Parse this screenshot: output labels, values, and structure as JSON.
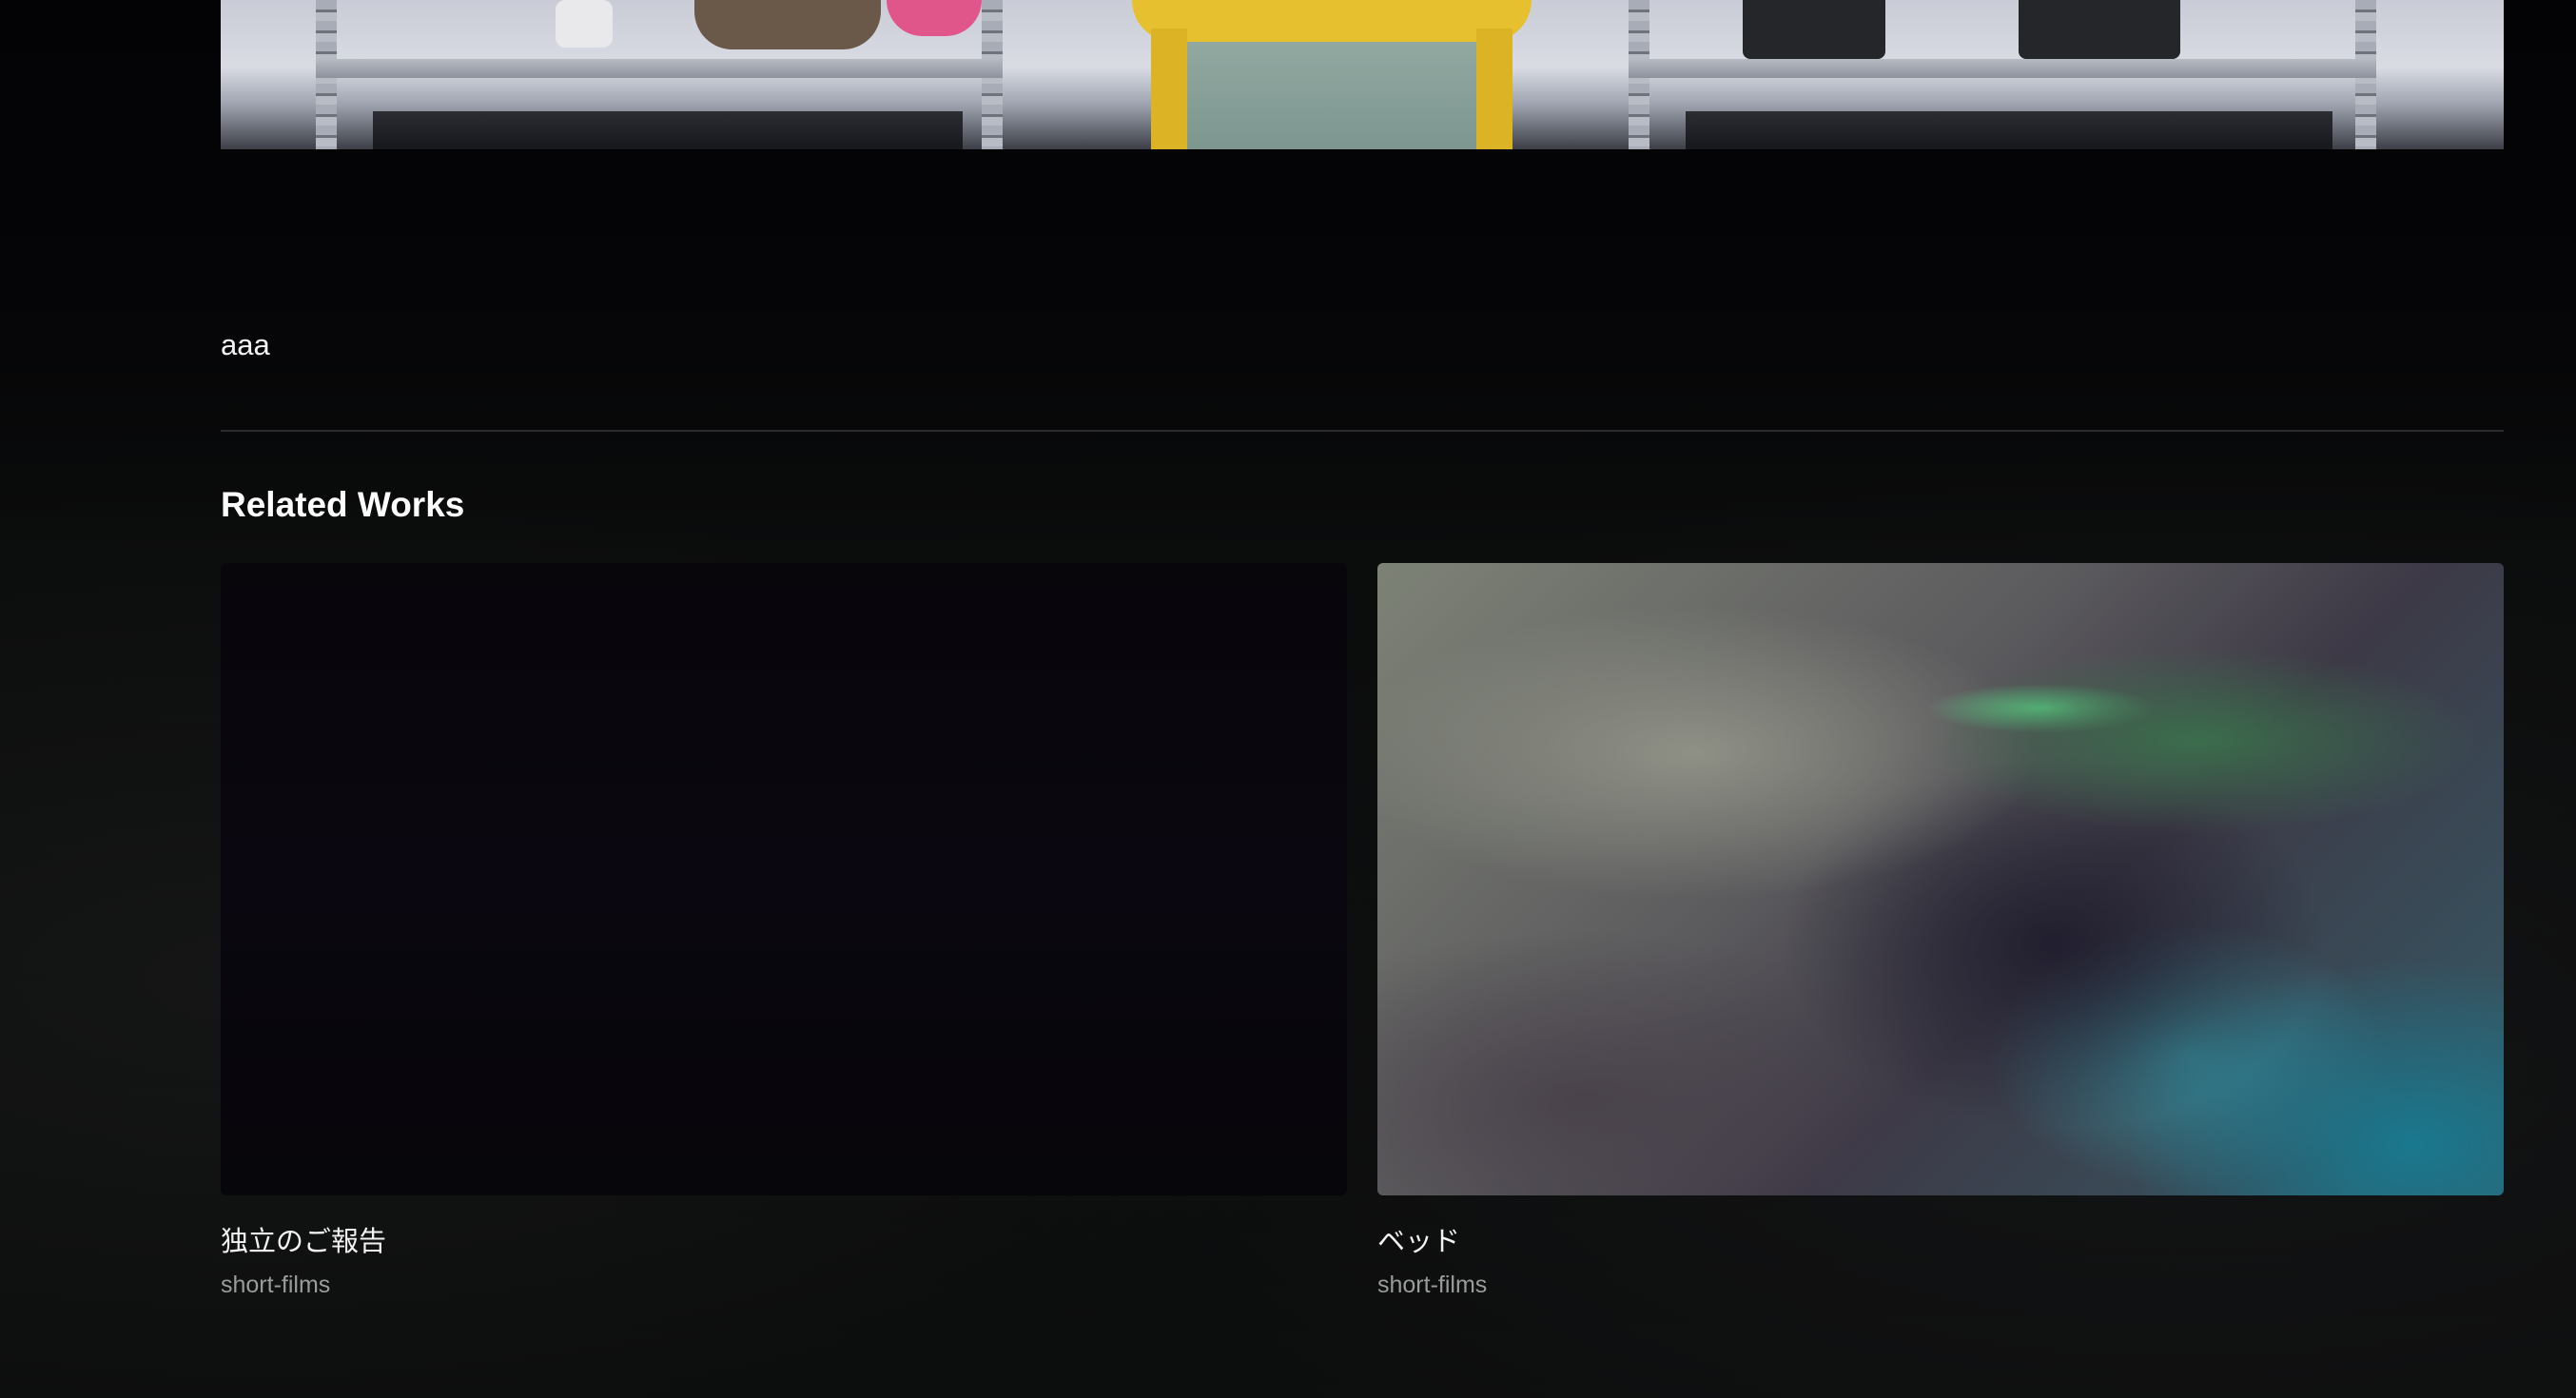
{
  "work": {
    "description": "aaa"
  },
  "related": {
    "heading": "Related Works",
    "items": [
      {
        "title": "独立のご報告",
        "category": "short-films"
      },
      {
        "title": "ベッド",
        "category": "short-films"
      }
    ]
  }
}
